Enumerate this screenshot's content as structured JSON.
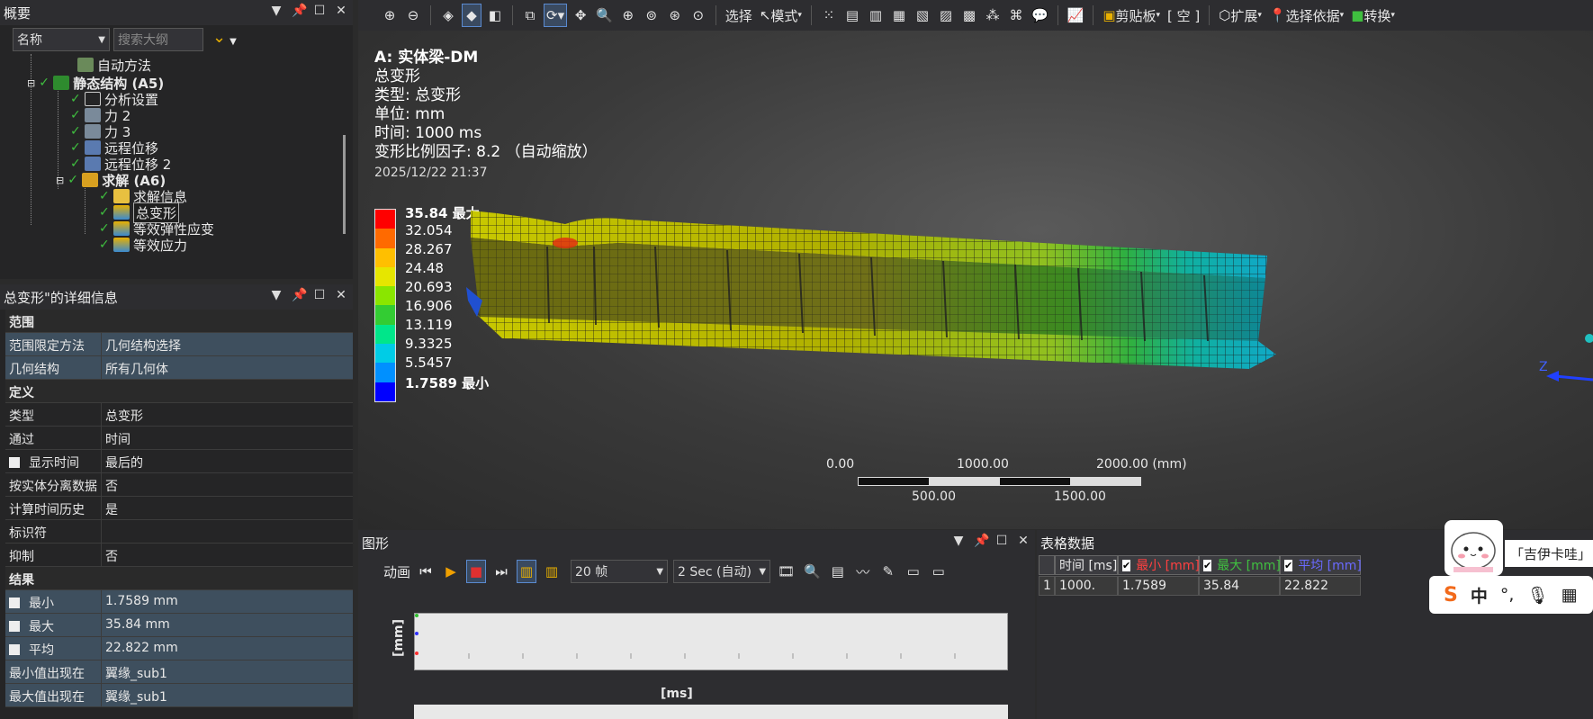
{
  "outline": {
    "title": "概要",
    "filter_field": "名称",
    "search_placeholder": "搜索大纲",
    "items": [
      {
        "label": "自动方法"
      },
      {
        "label": "静态结构 (A5)"
      },
      {
        "label": "分析设置"
      },
      {
        "label": "力 2"
      },
      {
        "label": "力 3"
      },
      {
        "label": "远程位移"
      },
      {
        "label": "远程位移 2"
      },
      {
        "label": "求解 (A6)"
      },
      {
        "label": "求解信息"
      },
      {
        "label": "总变形"
      },
      {
        "label": "等效弹性应变"
      },
      {
        "label": "等效应力"
      }
    ]
  },
  "details": {
    "title": "总变形\"的详细信息",
    "rows": [
      {
        "section": "范围"
      },
      {
        "key": "范围限定方法",
        "value": "几何结构选择"
      },
      {
        "key": "几何结构",
        "value": "所有几何体"
      },
      {
        "section": "定义"
      },
      {
        "key": "类型",
        "value": "总变形"
      },
      {
        "key": "通过",
        "value": "时间"
      },
      {
        "key": "显示时间",
        "value": "最后的"
      },
      {
        "key": "按实体分离数据",
        "value": "否"
      },
      {
        "key": "计算时间历史",
        "value": "是"
      },
      {
        "key": "标识符",
        "value": ""
      },
      {
        "key": "抑制",
        "value": "否"
      },
      {
        "section": "结果"
      },
      {
        "key": "最小",
        "value": "1.7589 mm"
      },
      {
        "key": "最大",
        "value": "35.84 mm"
      },
      {
        "key": "平均",
        "value": "22.822 mm"
      },
      {
        "key": "最小值出现在",
        "value": "翼缘_sub1"
      },
      {
        "key": "最大值出现在",
        "value": "翼缘_sub1"
      }
    ]
  },
  "toolbar": {
    "select_label": "选择",
    "mode_label": "模式",
    "clipboard_label": "剪贴板",
    "empty_label": "[ 空 ]",
    "extend_label": "扩展",
    "select_by_label": "选择依据",
    "convert_label": "转换"
  },
  "viewport": {
    "model": "A: 实体梁-DM",
    "result_name": "总变形",
    "type_line": "类型: 总变形",
    "unit_line": "单位: mm",
    "time_line": "时间: 1000 ms",
    "scale_line": "变形比例因子: 8.2 （自动缩放）",
    "timestamp": "2025/12/22 21:37",
    "legend": {
      "max_label": "35.84 最大",
      "min_label": "1.7589 最小",
      "values": [
        "32.054",
        "28.267",
        "24.48",
        "20.693",
        "16.906",
        "13.119",
        "9.3325",
        "5.5457"
      ],
      "colors": [
        "#ff0000",
        "#ff6a00",
        "#ffbf00",
        "#e6e600",
        "#8ae600",
        "#33cc33",
        "#00e68a",
        "#00cce6",
        "#0090ff",
        "#0000ff"
      ]
    },
    "scale_bar": {
      "top": [
        "0.00",
        "1000.00",
        "2000.00 (mm)"
      ],
      "bottom": [
        "500.00",
        "1500.00"
      ]
    },
    "axis_label": "Z"
  },
  "graph": {
    "title": "图形",
    "animation_label": "动画",
    "frames": "20 帧",
    "duration": "2 Sec (自动)",
    "y_label": "[mm]",
    "x_label": "[ms]"
  },
  "table": {
    "title": "表格数据",
    "columns": [
      "时间 [ms]",
      "最小 [mm]",
      "最大 [mm]",
      "平均 [mm]"
    ],
    "column_colors": [
      "#e8e8e8",
      "#ff4040",
      "#40c040",
      "#6a6aff"
    ],
    "rows": [
      {
        "index": "1",
        "cells": [
          "1000.",
          "1.7589",
          "35.84",
          "22.822"
        ]
      }
    ]
  },
  "ime": {
    "bubble": "「吉伊卡哇」",
    "chinese": "中"
  }
}
